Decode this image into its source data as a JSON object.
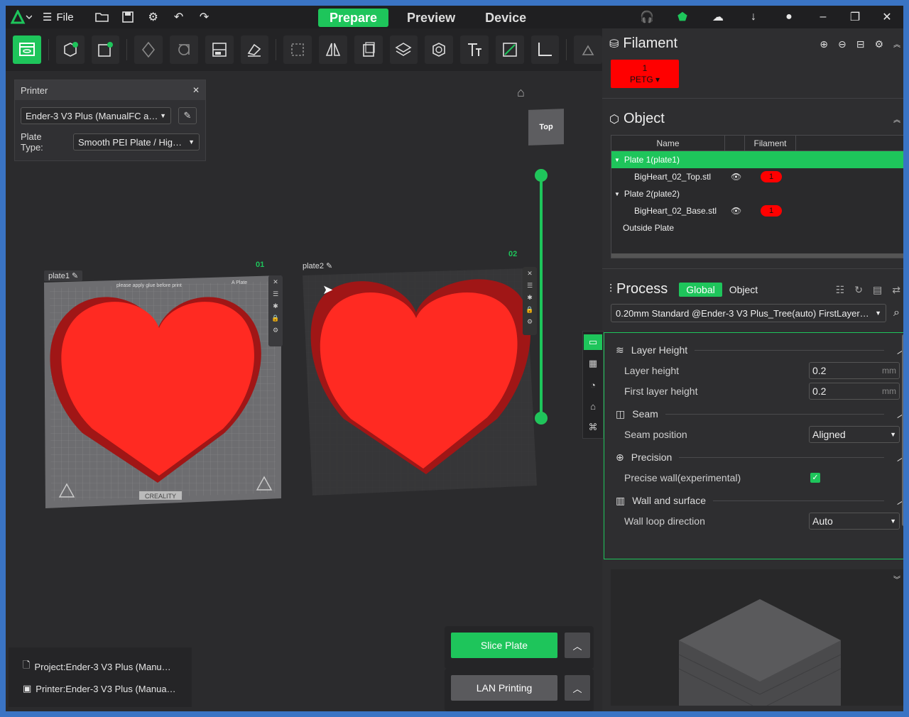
{
  "titlebar": {
    "file_label": "File",
    "tabs": [
      "Prepare",
      "Preview",
      "Device"
    ],
    "active_tab": "Prepare"
  },
  "printer_panel": {
    "title": "Printer",
    "printer_value": "Ender-3 V3 Plus (ManualFC a…",
    "plate_type_label": "Plate Type:",
    "plate_type_value": "Smooth PEI Plate / Hig…"
  },
  "viewport": {
    "viewcube_label": "Top",
    "plates": [
      {
        "label": "plate1",
        "number": "01"
      },
      {
        "label": "plate2",
        "number": "02"
      }
    ],
    "plate1_texts": {
      "sticker": "please apply glue before print",
      "brand": "CREALITY",
      "corner": "A Plate"
    }
  },
  "bottom_info": {
    "project": "Project:Ender-3 V3 Plus (Manu…",
    "printer": "Printer:Ender-3 V3 Plus (Manua…"
  },
  "actions": {
    "slice_label": "Slice Plate",
    "lan_label": "LAN Printing"
  },
  "filament": {
    "title": "Filament",
    "chip_index": "1",
    "chip_type": "PETG ▾",
    "chip_color": "#ff0000"
  },
  "object": {
    "title": "Object",
    "columns": [
      "Name",
      "Filament"
    ],
    "rows": [
      {
        "name": "Plate 1(plate1)",
        "type": "plate",
        "selected": true
      },
      {
        "name": "BigHeart_02_Top.stl",
        "type": "object",
        "filament": "1"
      },
      {
        "name": "Plate 2(plate2)",
        "type": "plate",
        "selected": false
      },
      {
        "name": "BigHeart_02_Base.stl",
        "type": "object",
        "filament": "1"
      },
      {
        "name": "Outside Plate",
        "type": "plate",
        "selected": false
      }
    ]
  },
  "process": {
    "title": "Process",
    "tabs": [
      "Global",
      "Object"
    ],
    "active_tab": "Global",
    "preset": "0.20mm Standard @Ender-3 V3 Plus_Tree(auto) FirstLayer…",
    "groups": {
      "layer_height": {
        "title": "Layer Height",
        "layer_height_label": "Layer height",
        "layer_height": "0.2",
        "first_layer_label": "First layer height",
        "first_layer": "0.2",
        "unit": "mm"
      },
      "seam": {
        "title": "Seam",
        "position_label": "Seam position",
        "position": "Aligned"
      },
      "precision": {
        "title": "Precision",
        "precise_wall_label": "Precise wall(experimental)",
        "precise_wall": true
      },
      "wall": {
        "title": "Wall and surface",
        "loop_dir_label": "Wall loop direction",
        "loop_dir": "Auto"
      }
    }
  },
  "colors": {
    "accent": "#1ec55b",
    "filament": "#ff0000",
    "heart": "#ff2a22"
  }
}
